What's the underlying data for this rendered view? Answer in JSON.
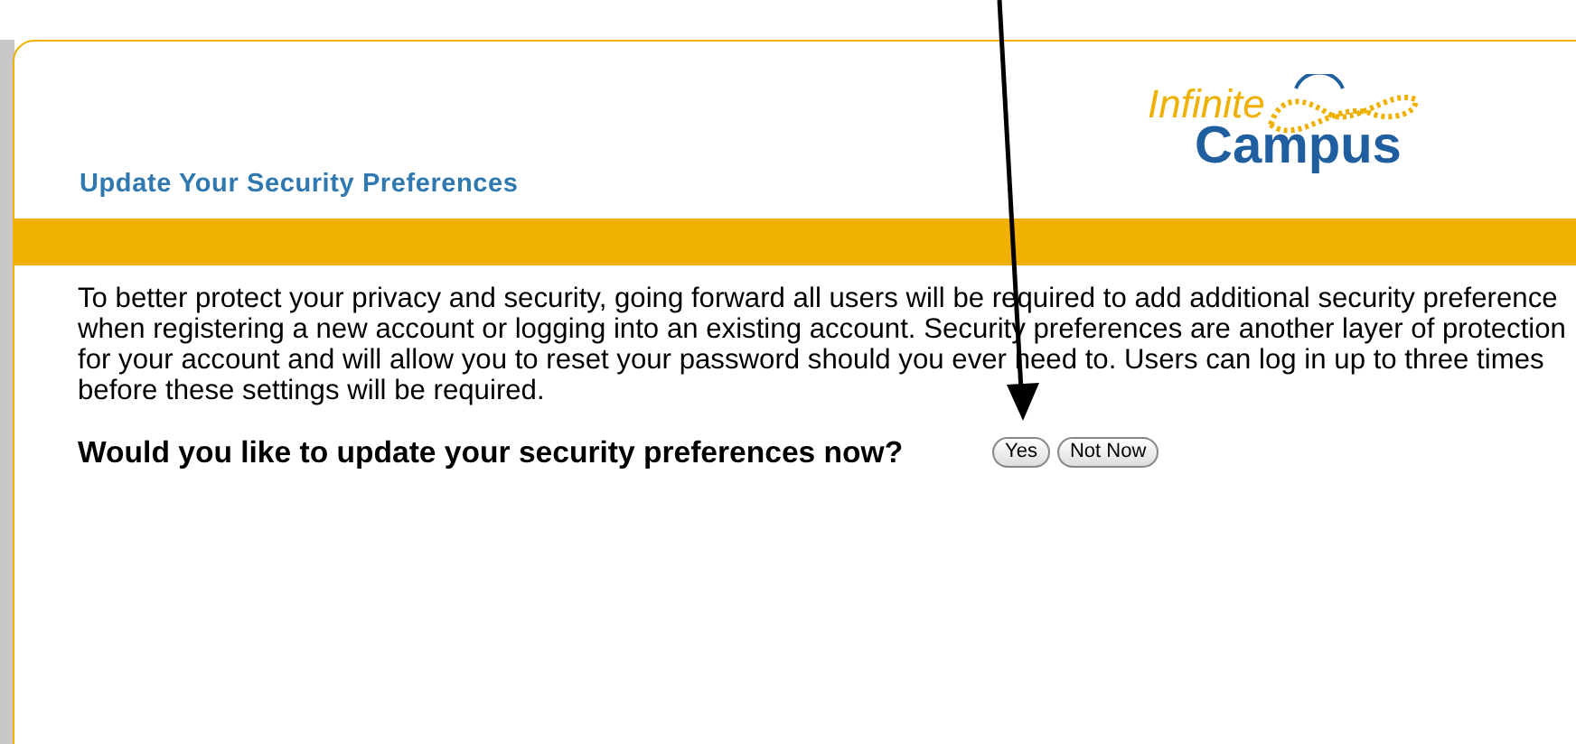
{
  "logo": {
    "line_1": "Infinite",
    "line_2": "Campus"
  },
  "page_title": "Update Your Security Preferences",
  "message_lines": [
    "To better protect your privacy and security, going forward all users will be required to add additional security preference",
    "when registering a new account or logging into an existing account. Security preferences are another layer of protection",
    "for your account and will allow you to reset your password should you ever need to. Users can log in up to three times",
    "before these settings will be required."
  ],
  "question": "Would you like to update your security preferences now?",
  "buttons": [
    "Yes",
    "Not Now"
  ]
}
